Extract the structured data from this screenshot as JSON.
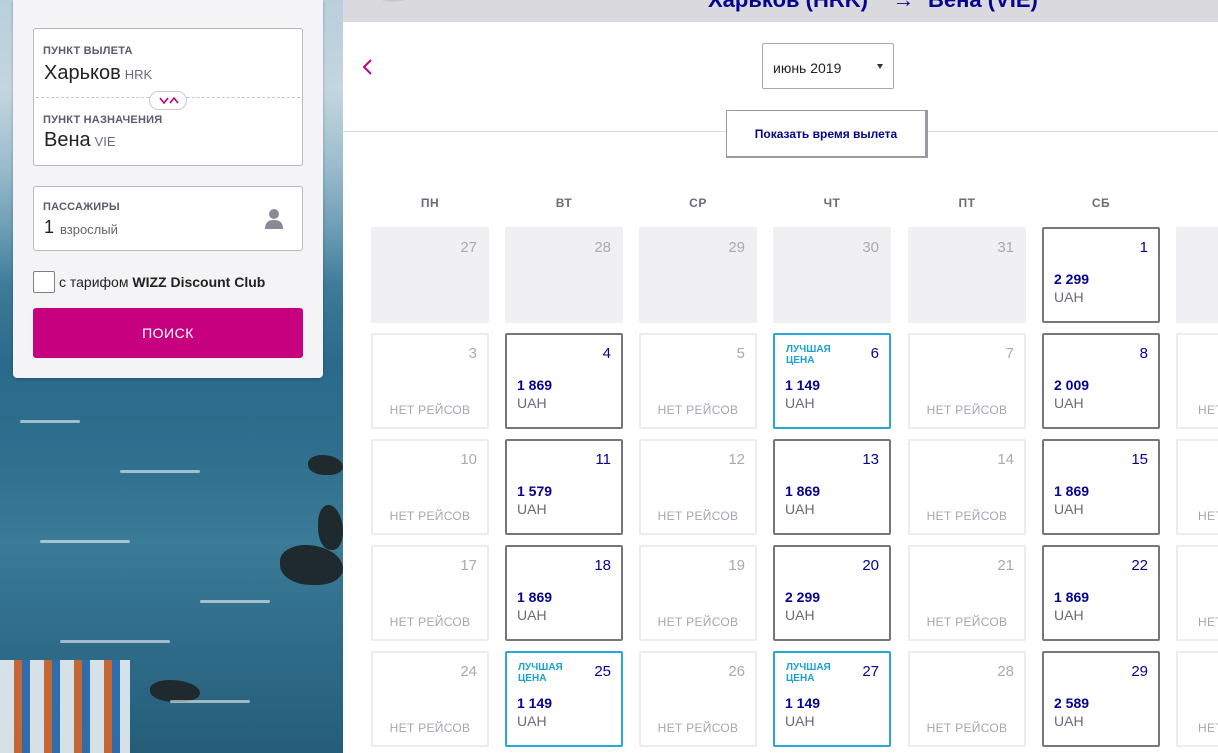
{
  "search_panel": {
    "origin_label": "ПУНКТ ВЫЛЕТА",
    "origin_city": "Харьков",
    "origin_code": "HRK",
    "destination_label": "ПУНКТ НАЗНАЧЕНИЯ",
    "destination_city": "Вена",
    "destination_code": "VIE",
    "passengers_label": "ПАССАЖИРЫ",
    "passengers_count": "1",
    "passengers_unit": "взрослый",
    "discount_prefix": "с тарифом ",
    "discount_name": "WIZZ Discount Club",
    "search_button": "ПОИСК"
  },
  "header": {
    "route_from": "Харьков (HRK)",
    "route_to": "Вена (VIE)"
  },
  "calendar": {
    "month": "июнь 2019",
    "show_times_button": "Показать время вылета",
    "weekdays": [
      "ПН",
      "ВТ",
      "СР",
      "ЧТ",
      "ПТ",
      "СБ"
    ],
    "no_flights_text": "НЕТ РЕЙСОВ",
    "best_price_text": "ЛУЧШАЯ ЦЕНА",
    "currency": "UAH",
    "weeks": [
      [
        {
          "day": "27",
          "state": "past"
        },
        {
          "day": "28",
          "state": "past"
        },
        {
          "day": "29",
          "state": "past"
        },
        {
          "day": "30",
          "state": "past"
        },
        {
          "day": "31",
          "state": "past"
        },
        {
          "day": "1",
          "state": "price",
          "price": "2 299"
        }
      ],
      [
        {
          "day": "3",
          "state": "none"
        },
        {
          "day": "4",
          "state": "price",
          "price": "1 869"
        },
        {
          "day": "5",
          "state": "none"
        },
        {
          "day": "6",
          "state": "best",
          "price": "1 149"
        },
        {
          "day": "7",
          "state": "none"
        },
        {
          "day": "8",
          "state": "price",
          "price": "2 009"
        }
      ],
      [
        {
          "day": "10",
          "state": "none"
        },
        {
          "day": "11",
          "state": "price",
          "price": "1 579"
        },
        {
          "day": "12",
          "state": "none"
        },
        {
          "day": "13",
          "state": "price",
          "price": "1 869"
        },
        {
          "day": "14",
          "state": "none"
        },
        {
          "day": "15",
          "state": "price",
          "price": "1 869"
        }
      ],
      [
        {
          "day": "17",
          "state": "none"
        },
        {
          "day": "18",
          "state": "price",
          "price": "1 869"
        },
        {
          "day": "19",
          "state": "none"
        },
        {
          "day": "20",
          "state": "price",
          "price": "2 299"
        },
        {
          "day": "21",
          "state": "none"
        },
        {
          "day": "22",
          "state": "price",
          "price": "1 869"
        }
      ],
      [
        {
          "day": "24",
          "state": "none"
        },
        {
          "day": "25",
          "state": "best",
          "price": "1 149"
        },
        {
          "day": "26",
          "state": "none"
        },
        {
          "day": "27",
          "state": "best",
          "price": "1 149"
        },
        {
          "day": "28",
          "state": "none"
        },
        {
          "day": "29",
          "state": "price",
          "price": "2 589"
        }
      ]
    ],
    "sunday_partial": [
      {
        "state": "past"
      },
      {
        "state": "none",
        "text": "НЕТ"
      },
      {
        "state": "none",
        "text": "НЕТ"
      },
      {
        "state": "none",
        "text": "НЕТ"
      },
      {
        "state": "none",
        "text": "НЕТ"
      }
    ]
  },
  "colors": {
    "brand_magenta": "#c6007e",
    "brand_navy": "#06038d",
    "best_price_blue": "#1ba0d5"
  }
}
